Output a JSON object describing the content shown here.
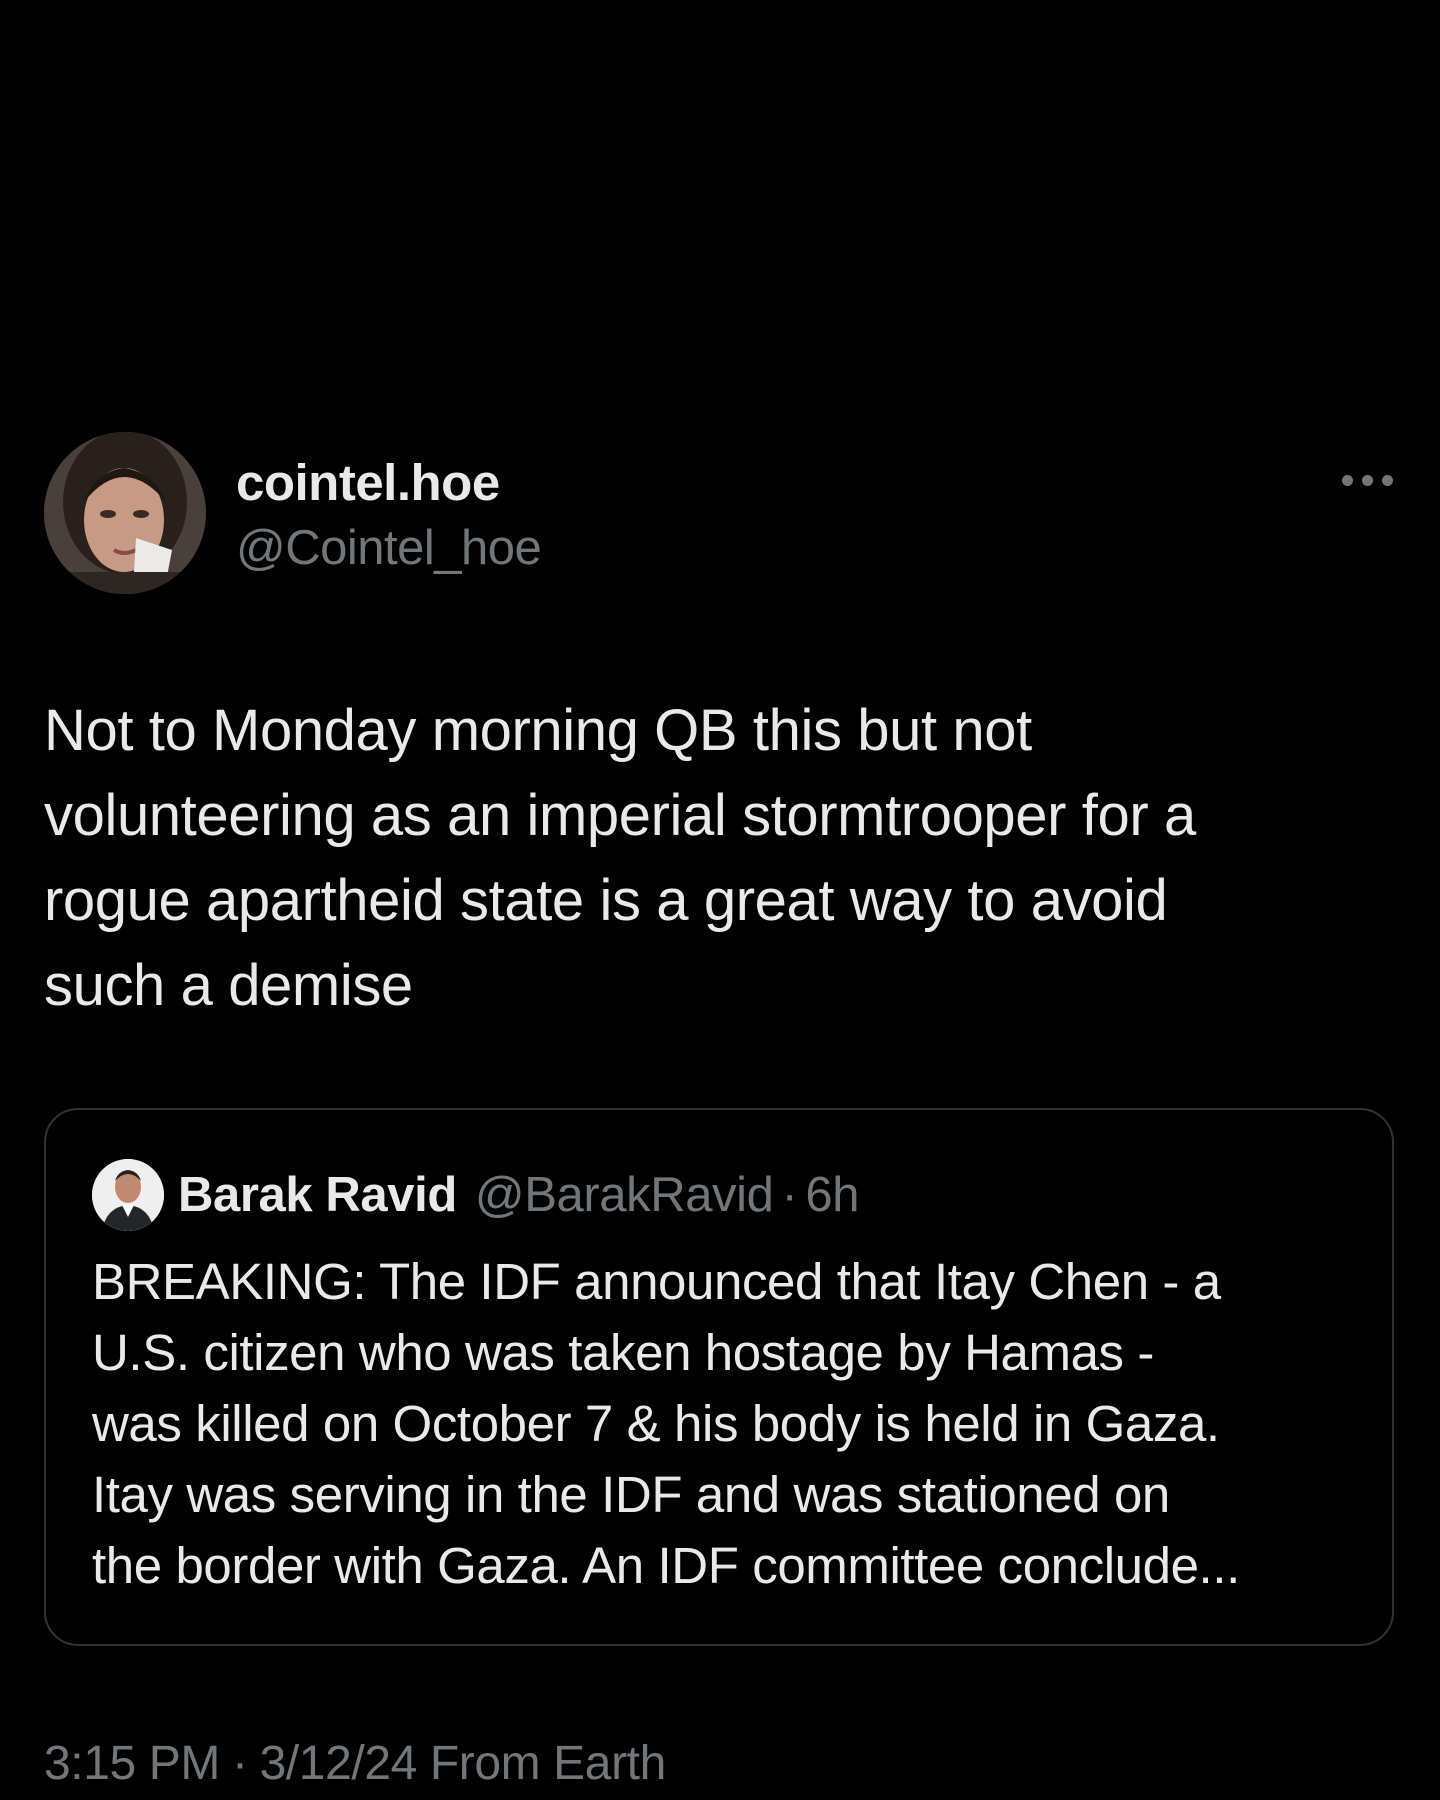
{
  "tweet": {
    "author": {
      "display_name": "cointel.hoe",
      "handle": "@Cointel_hoe"
    },
    "more_icon": "ellipsis-icon",
    "text": "Not to Monday morning QB this but not\nvolunteering as an imperial stormtrooper for a\nrogue apartheid state is a great way to avoid\nsuch a demise",
    "quoted": {
      "display_name": "Barak Ravid",
      "handle": "@BarakRavid",
      "separator": "·",
      "time": "6h",
      "text": "BREAKING: The IDF announced that Itay Chen - a\nU.S. citizen  who was taken hostage by Hamas -\nwas killed on October 7 & his body is held in Gaza.\nItay was serving in the IDF and was stationed on\nthe border with Gaza. An IDF committee conclude..."
    },
    "meta": {
      "time": "3:15 PM",
      "separator": "·",
      "date": "3/12/24",
      "source": "From Earth"
    }
  },
  "colors": {
    "background": "#000000",
    "primary_text": "#e7e9ea",
    "secondary_text": "#71767b",
    "border": "#2f3336"
  }
}
